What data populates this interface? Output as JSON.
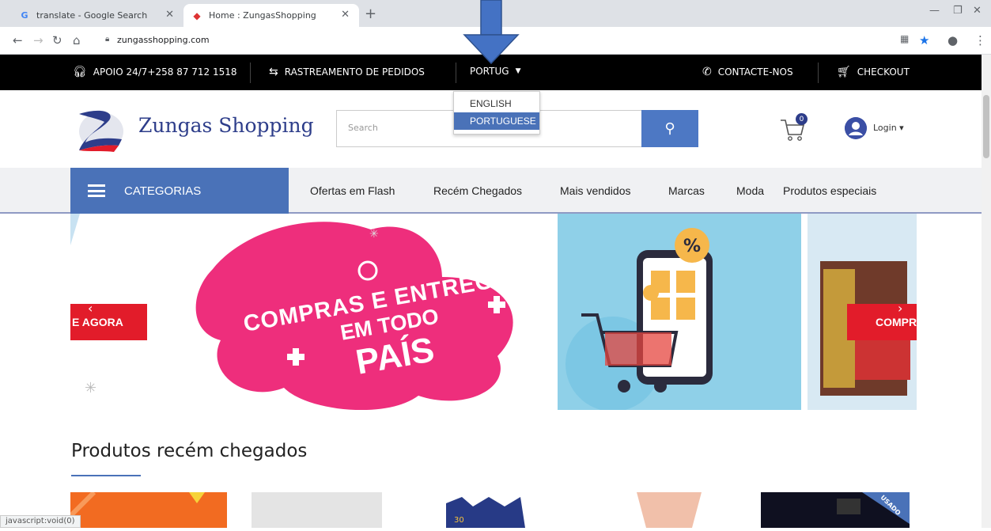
{
  "browser": {
    "tabs": [
      {
        "title": "translate - Google Search",
        "favicon": "G"
      },
      {
        "title": "Home : ZungasShopping",
        "favicon": "Z"
      }
    ],
    "url": "zungasshopping.com",
    "status_text": "javascript:void(0)"
  },
  "topbar": {
    "support": "APOIO 24/7+258 87 712 1518",
    "tracking": "RASTREAMENTO DE PEDIDOS",
    "language": "PORTUG",
    "contact": "CONTACTE-NOS",
    "checkout": "CHECKOUT"
  },
  "language_dropdown": {
    "options": [
      "ENGLISH",
      "PORTUGUESE"
    ],
    "selected": "PORTUGUESE"
  },
  "header": {
    "logo_text": "Zungas Shopping",
    "search_placeholder": "Search",
    "cart_count": "0",
    "login": "Login"
  },
  "nav": {
    "categories": "CATEGORIAS",
    "links": [
      "Ofertas em Flash",
      "Recém Chegados",
      "Mais vendidos",
      "Marcas",
      "Moda",
      "Produtos especiais"
    ]
  },
  "banner": {
    "headline_1": "COMPRAS E ENTREGAS",
    "headline_2": "EM TODO",
    "headline_3": "PAÍS",
    "left_button": "E AGORA",
    "right_button": "COMPR",
    "badge": "%"
  },
  "section": {
    "title": "Produtos recém chegados",
    "used_badge": "USADO"
  }
}
